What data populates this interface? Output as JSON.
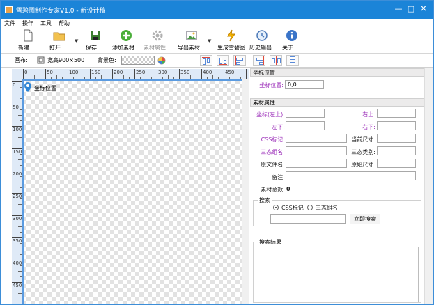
{
  "window": {
    "title": "雪碧图制作专家V1.0 - 新设计稿"
  },
  "menu": [
    "文件",
    "操作",
    "工具",
    "帮助"
  ],
  "toolbar": {
    "new": "新建",
    "open": "打开",
    "save": "保存",
    "add_material": "添加素材",
    "material_props": "素材属性",
    "export_material": "导出素材",
    "generate_sprite": "生成雪碧图",
    "history_output": "历史输出",
    "about": "关于"
  },
  "canvas_bar": {
    "canvas_label": "画布:",
    "size_text": "宽高900×500",
    "bg_label": "背景色:"
  },
  "ruler": {
    "h_ticks": [
      "0",
      "50",
      "100",
      "150",
      "200",
      "250",
      "300",
      "350",
      "400",
      "450"
    ],
    "v_ticks": [
      "0",
      "50",
      "100",
      "150",
      "200",
      "250",
      "300",
      "350",
      "400",
      "450"
    ]
  },
  "canvas": {
    "pin_label": "坐标位置"
  },
  "coord_panel": {
    "title": "坐标位置",
    "pos_label": "坐标位置:",
    "pos_value": "0,0"
  },
  "material_panel": {
    "title": "素材属性",
    "top_left": "坐标(左上):",
    "top_right": "右上:",
    "bottom_left": "左下:",
    "bottom_right": "右下:",
    "css_label": "CSS标记:",
    "current_size": "当前尺寸:",
    "tri_group": "三态组名:",
    "tri_type": "三态类别:",
    "orig_name": "原文件名:",
    "orig_size": "原始尺寸:",
    "note": "备注:",
    "total_label": "素材总数:",
    "total_value": "0"
  },
  "search": {
    "title": "搜索",
    "opt_css": "CSS标记",
    "opt_tri": "三态组名",
    "button": "立即搜索"
  },
  "results": {
    "title": "搜索结果"
  },
  "colors": {
    "titlebar": "#1b84d8",
    "purple_label": "#9a2bb8",
    "ruler_bg": "#dfeaf7"
  }
}
